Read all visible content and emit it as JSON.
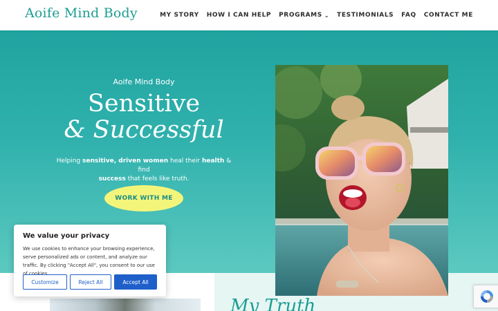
{
  "header": {
    "logo": "Aoife Mind Body",
    "nav": [
      {
        "label": "MY STORY"
      },
      {
        "label": "HOW I CAN HELP"
      },
      {
        "label": "PROGRAMS",
        "has_dropdown": true
      },
      {
        "label": "TESTIMONIALS"
      },
      {
        "label": "FAQ"
      },
      {
        "label": "CONTACT ME"
      }
    ]
  },
  "hero": {
    "brand": "Aoife Mind Body",
    "title_line1": "Sensitive",
    "title_line2": "& Successful",
    "subtitle": {
      "t1": "Helping ",
      "b1": "sensitive, driven women",
      "t2": " heal their ",
      "b2": "health",
      "t3": " & find ",
      "b3": "success",
      "t4": " that feels like truth."
    },
    "cta_label": "WORK WITH ME"
  },
  "section": {
    "title": "My Truth"
  },
  "cookie": {
    "title": "We value your privacy",
    "text": "We use cookies to enhance your browsing experience, serve personalized ads or content, and analyze our traffic. By clicking \"Accept All\", you consent to our use of cookies.",
    "customize": "Customize",
    "reject": "Reject All",
    "accept": "Accept All"
  },
  "colors": {
    "brand": "#1c9d93",
    "hero_gradient_top": "#20a3a0",
    "hero_gradient_bottom": "#5cc9c0",
    "cta": "#f3f57a",
    "cookie_button": "#1e5fc9"
  }
}
